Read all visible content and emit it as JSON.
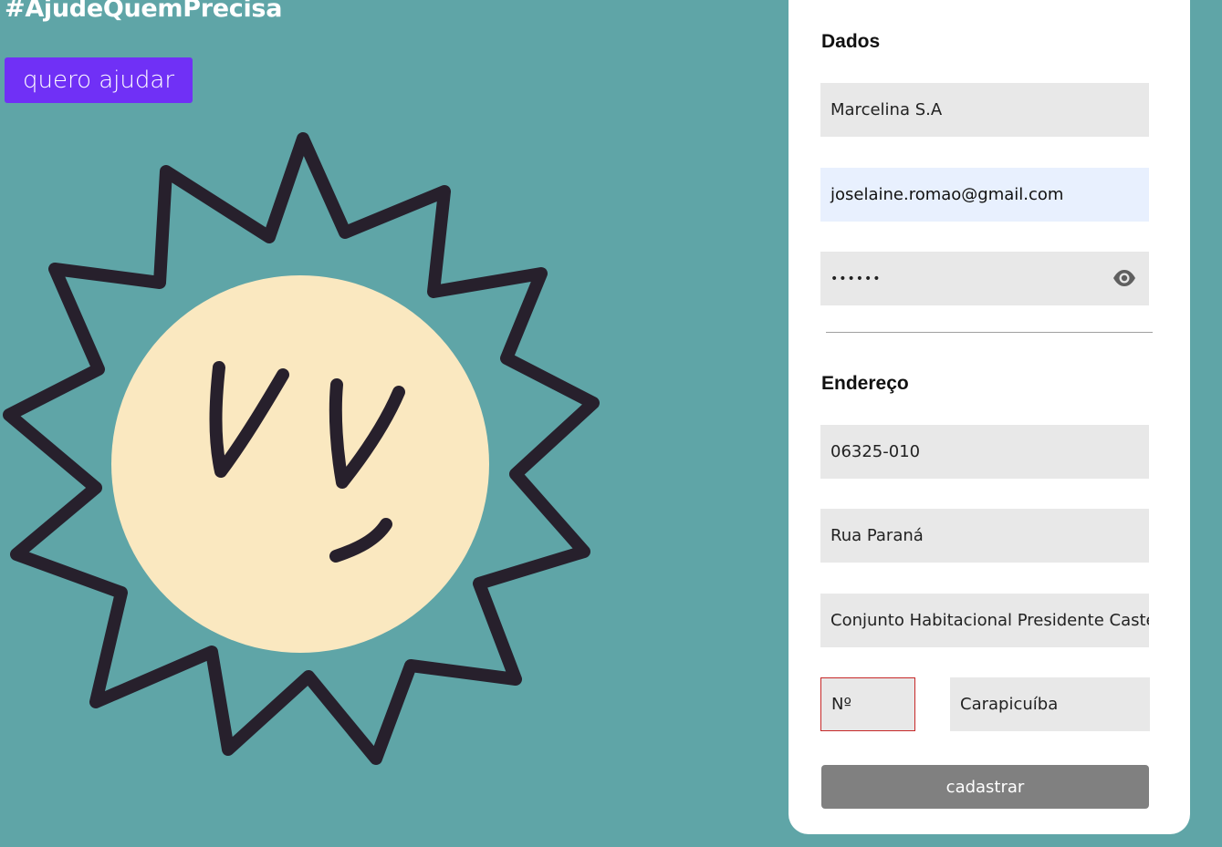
{
  "hero": {
    "hashtag": "#AjudeQuemPrecisa",
    "help_button": "quero ajudar"
  },
  "form": {
    "data_section": {
      "title": "Dados",
      "name_value": "Marcelina S.A",
      "email_value": "joselaine.romao@gmail.com",
      "password_value": "••••••"
    },
    "address_section": {
      "title": "Endereço",
      "cep_value": "06325-010",
      "street_value": "Rua Paraná",
      "neighborhood_value": "Conjunto Habitacional Presidente Castelo Branco",
      "number_placeholder": "Nº",
      "city_value": "Carapicuíba"
    },
    "submit_label": "cadastrar"
  },
  "colors": {
    "background": "#5fa5a7",
    "accent": "#7030f6",
    "sun_face": "#fae8c0",
    "sun_outline": "#27202c",
    "submit_disabled": "#808080",
    "error_border": "#c62828"
  },
  "icons": {
    "password_toggle": "eye-icon",
    "illustration": "sun-illustration"
  }
}
